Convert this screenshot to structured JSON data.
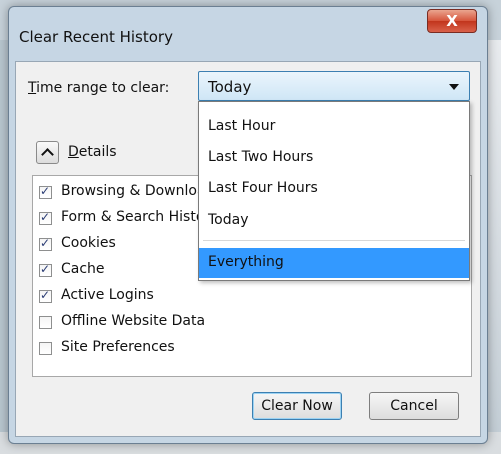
{
  "window": {
    "title": "Clear Recent History",
    "close_glyph": "X"
  },
  "time_range": {
    "label_accesskey": "T",
    "label_rest": "ime range to clear:",
    "selected_value": "Today",
    "options": [
      "Last Hour",
      "Last Two Hours",
      "Last Four Hours",
      "Today",
      "Everything"
    ],
    "highlighted_option": "Everything"
  },
  "details": {
    "label_accesskey": "D",
    "label_rest": "etails",
    "icon": "chevron-up-icon"
  },
  "items": [
    {
      "label": "Browsing & Download History",
      "checked": true
    },
    {
      "label": "Form & Search History",
      "checked": true
    },
    {
      "label": "Cookies",
      "checked": true
    },
    {
      "label": "Cache",
      "checked": true
    },
    {
      "label": "Active Logins",
      "checked": true
    },
    {
      "label": "Offline Website Data",
      "checked": false
    },
    {
      "label": "Site Preferences",
      "checked": false
    }
  ],
  "buttons": {
    "clear_now": "Clear Now",
    "cancel": "Cancel"
  },
  "colors": {
    "highlight": "#3399ff",
    "close_button": "#c7432a"
  }
}
